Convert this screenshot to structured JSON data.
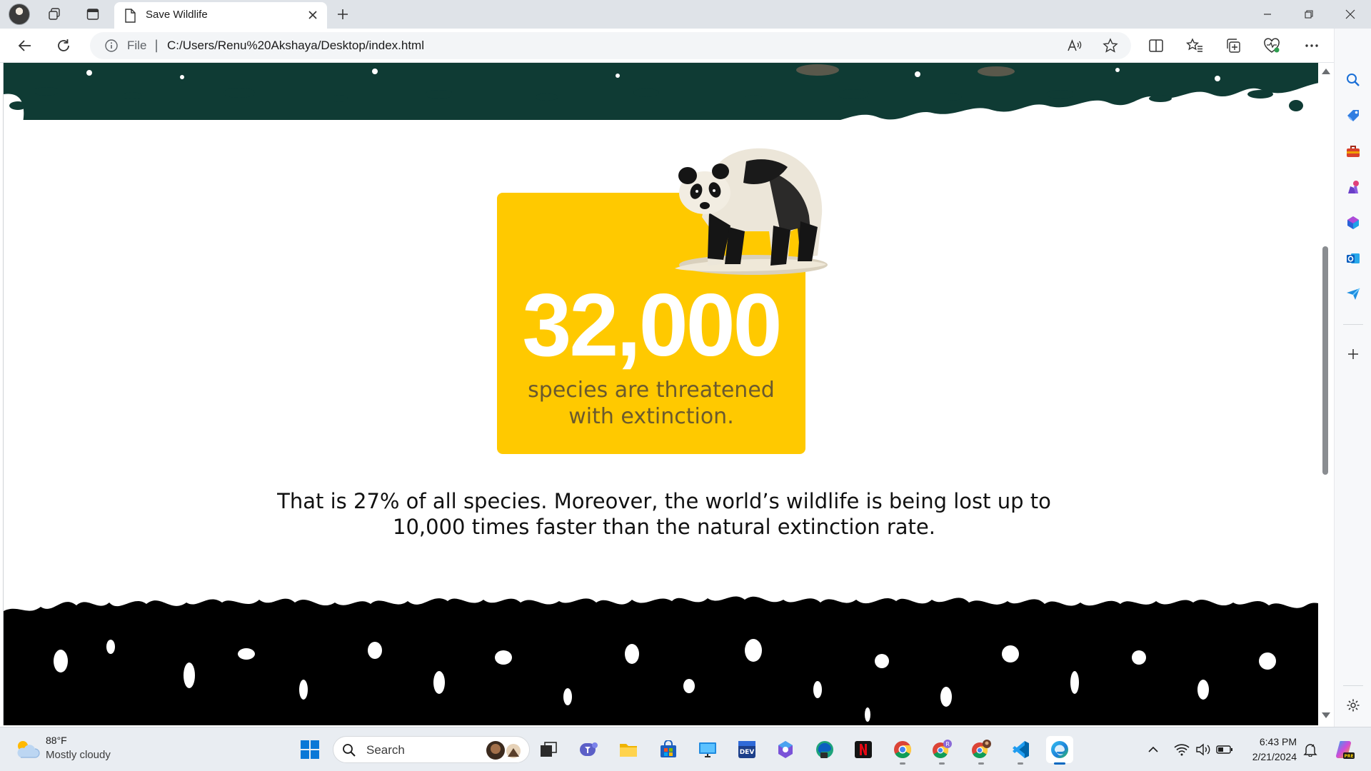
{
  "browser": {
    "tab": {
      "title": "Save Wildlife"
    },
    "address": {
      "scheme_label": "File",
      "url": "C:/Users/Renu%20Akshaya/Desktop/index.html"
    },
    "toolbar_icons": [
      "back-arrow-icon",
      "refresh-icon",
      "info-icon",
      "read-aloud-icon",
      "favorite-star-icon",
      "split-screen-icon",
      "favorites-icon",
      "collections-icon",
      "browser-essentials-icon",
      "more-menu-icon",
      "copilot-icon"
    ],
    "sidebar_icons": [
      "search-icon",
      "shopping-tag-icon",
      "tools-briefcase-icon",
      "games-icon",
      "microsoft-365-icon",
      "outlook-icon",
      "drop-send-icon",
      "add-icon",
      "settings-gear-icon"
    ]
  },
  "page": {
    "stat": {
      "number": "32,000",
      "caption_line1": "species are threatened",
      "caption_line2": "with extinction."
    },
    "body_line1": "That is 27% of all species. Moreover, the world’s wildlife is being lost up to",
    "body_line2": "10,000 times faster than the natural extinction rate.",
    "card_color": "#ffc900",
    "scroll_position": 0.42
  },
  "taskbar": {
    "weather": {
      "temp": "88°F",
      "condition": "Mostly cloudy"
    },
    "search": {
      "label": "Search"
    },
    "apps": [
      "windows-start-icon",
      "task-view-icon",
      "teams-icon",
      "file-explorer-icon",
      "microsoft-store-icon",
      "remote-desktop-icon",
      "dev-home-icon",
      "copilot-app-icon",
      "edge-dev-icon",
      "netflix-icon",
      "chrome-icon",
      "chrome-profile-r-icon",
      "chrome-profile-2-icon",
      "vscode-icon",
      "edge-icon"
    ],
    "clock": {
      "time": "6:43 PM",
      "date": "2/21/2024"
    }
  }
}
